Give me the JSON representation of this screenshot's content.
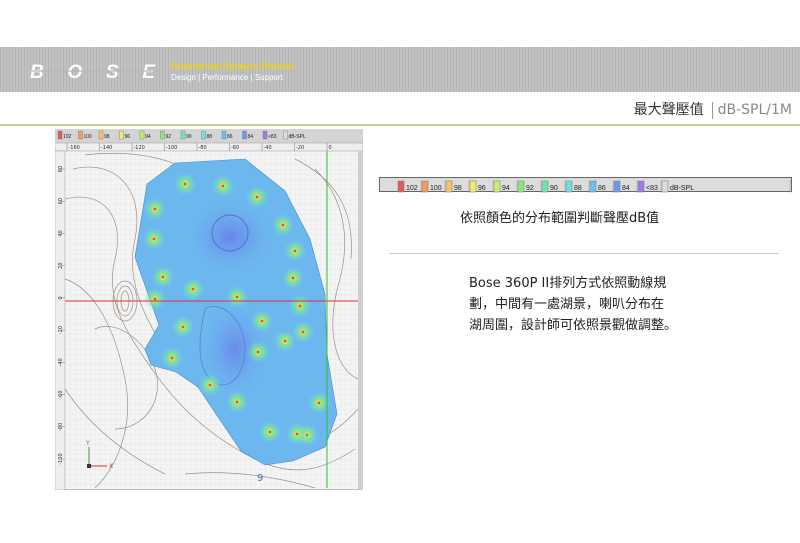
{
  "header": {
    "brand": "BOSE",
    "division": "Professional Systems Division",
    "tagline": "Design | Performance | Support"
  },
  "title": {
    "main": "最大聲壓值",
    "unit": "dB-SPL/1M"
  },
  "legend": {
    "items": [
      {
        "label": "102",
        "color": "#e35c5c"
      },
      {
        "label": "100",
        "color": "#f39a5c"
      },
      {
        "label": "98",
        "color": "#f3c26c"
      },
      {
        "label": "96",
        "color": "#f3e96c"
      },
      {
        "label": "94",
        "color": "#c7f06c"
      },
      {
        "label": "92",
        "color": "#8de87a"
      },
      {
        "label": "90",
        "color": "#74e4b0"
      },
      {
        "label": "88",
        "color": "#6ee0e0"
      },
      {
        "label": "86",
        "color": "#6cc2ee"
      },
      {
        "label": "84",
        "color": "#6c98ee"
      },
      {
        "label": "<83",
        "color": "#a07ae8"
      },
      {
        "label": "dB-SPL",
        "color": "#dcdcdc"
      }
    ]
  },
  "map": {
    "x_ticks": [
      "-160",
      "-140",
      "-120",
      "-100",
      "-80",
      "-60",
      "-40",
      "-20",
      "0"
    ],
    "y_ticks": [
      "80",
      "60",
      "40",
      "20",
      "0",
      "-20",
      "-40",
      "-60",
      "-80",
      "-100"
    ],
    "axis_y": "Y",
    "axis_x": "X",
    "corner_mark": "9"
  },
  "caption": "依照顏色的分布範圍判斷聲壓dB值",
  "description": {
    "lines": [
      "Bose 360P II排列方式依照動線規",
      "劃，中間有一處湖景，喇叭分布在",
      "湖周圍，設計師可依照景觀做調整。"
    ]
  }
}
